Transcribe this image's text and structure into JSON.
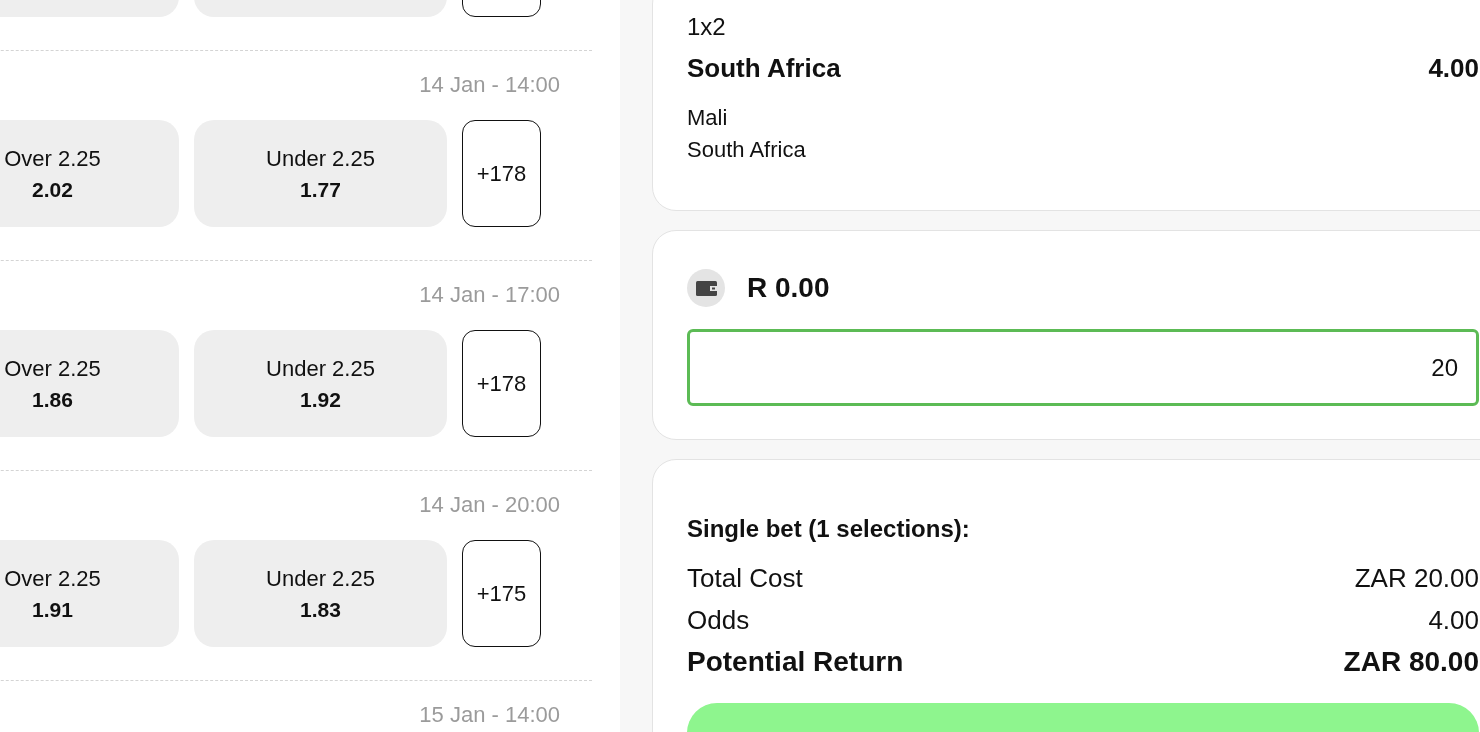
{
  "matches": [
    {
      "kind": "cut"
    },
    {
      "kind": "full",
      "time": "14 Jan - 14:00",
      "over": {
        "label": "Over 2.25",
        "odds": "2.02"
      },
      "under": {
        "label": "Under 2.25",
        "odds": "1.77"
      },
      "more": "+178"
    },
    {
      "kind": "full",
      "time": "14 Jan - 17:00",
      "over": {
        "label": "Over 2.25",
        "odds": "1.86"
      },
      "under": {
        "label": "Under 2.25",
        "odds": "1.92"
      },
      "more": "+178"
    },
    {
      "kind": "full",
      "time": "14 Jan - 20:00",
      "over": {
        "label": "Over 2.25",
        "odds": "1.91"
      },
      "under": {
        "label": "Under 2.25",
        "odds": "1.83"
      },
      "more": "+175"
    },
    {
      "kind": "time_only",
      "time": "15 Jan - 14:00"
    }
  ],
  "bet_slip": {
    "selection": {
      "market": "1x2",
      "pick": "South Africa",
      "odds": "4.00",
      "teams": [
        "Mali",
        "South Africa"
      ]
    },
    "balance": "R 0.00",
    "stake": "20",
    "summary": {
      "title": "Single bet (1 selections):",
      "rows": [
        {
          "label": "Total Cost",
          "value": "ZAR 20.00",
          "bold": false
        },
        {
          "label": "Odds",
          "value": "4.00",
          "bold": false
        },
        {
          "label": "Potential Return",
          "value": "ZAR 80.00",
          "bold": true
        }
      ]
    }
  }
}
